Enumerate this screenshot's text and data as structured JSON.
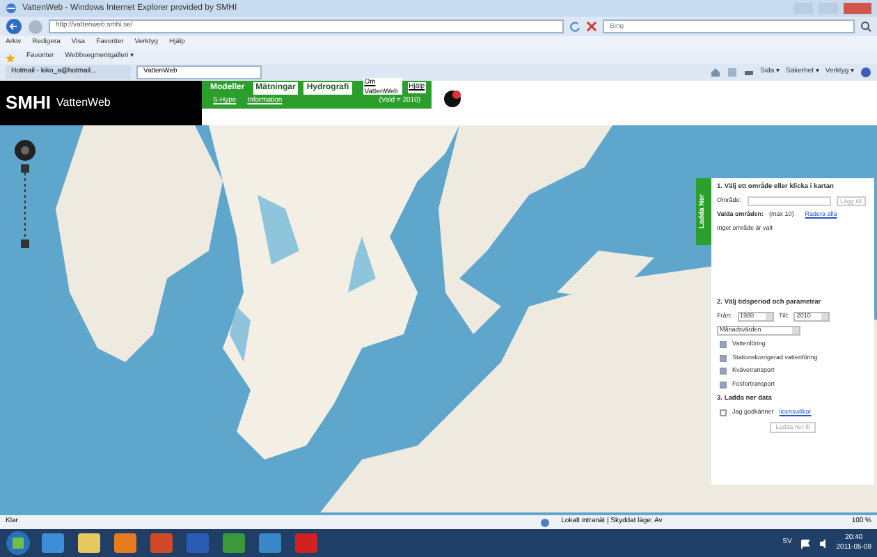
{
  "window": {
    "title": "VattenWeb - Windows Internet Explorer provided by SMHI"
  },
  "address_bar": {
    "url": "http://vattenweb.smhi.se/",
    "search_placeholder": "Bing"
  },
  "menu": [
    "Arkiv",
    "Redigera",
    "Visa",
    "Favoriter",
    "Verktyg",
    "Hjälp"
  ],
  "favorites_bar": {
    "favorites": "Favoriter",
    "gallery": "Webbsegmentgalleri ▾"
  },
  "browser_tabs": [
    {
      "label": "Hotmail - kiko_a@hotmail...",
      "selected": false
    },
    {
      "label": "VattenWeb",
      "selected": true
    }
  ],
  "command_bar": [
    "Sida ▾",
    "Säkerhet ▾",
    "Verktyg ▾"
  ],
  "app": {
    "logo": "SMHI",
    "name": "VattenWeb",
    "nav_tabs": [
      {
        "label": "Modeller",
        "selected": true
      },
      {
        "label": "Mätningar",
        "selected": false
      },
      {
        "label": "Hydrografi",
        "selected": false
      }
    ],
    "sub_links": [
      "S-Hype",
      "Information"
    ],
    "top_links": [
      "Om VattenWeb",
      "Hjälp"
    ],
    "selection_note": "(Vald = 2010)"
  },
  "panel": {
    "side_tab": "Ladda Ner",
    "step1": {
      "heading": "1. Välj ett område eller klicka i kartan",
      "area_label": "Område:",
      "add_button": "Lägg till",
      "chosen_label": "Valda områden:",
      "chosen_max": "(max 10)",
      "clear_link": "Radera alla",
      "empty_note": "Inget område är valt"
    },
    "step2": {
      "heading": "2. Välj tidsperiod och parametrar",
      "from_label": "Från:",
      "from_value": "1980",
      "to_label": "Till:",
      "to_value": "2010",
      "interval": "Månadsvärden",
      "parameters": [
        {
          "label": "Vattenföring",
          "checked": true
        },
        {
          "label": "Stationskorrigerad vattenföring",
          "checked": true
        },
        {
          "label": "Kvävetransport",
          "checked": true
        },
        {
          "label": "Fosfortransport",
          "checked": true
        }
      ]
    },
    "step3": {
      "heading": "3. Ladda ner data",
      "accept_text": "Jag godkänner",
      "license_link": "licensvillkor",
      "accepted": false,
      "download_button": "Ladda ner fil",
      "download_disabled": true
    }
  },
  "status_bar": {
    "left": "Klar",
    "zone": "Lokalt intranät | Skyddat läge: Av",
    "zoom": "100 %"
  },
  "taskbar": {
    "language": "SV",
    "time": "20:40",
    "date": "2011-05-08"
  }
}
